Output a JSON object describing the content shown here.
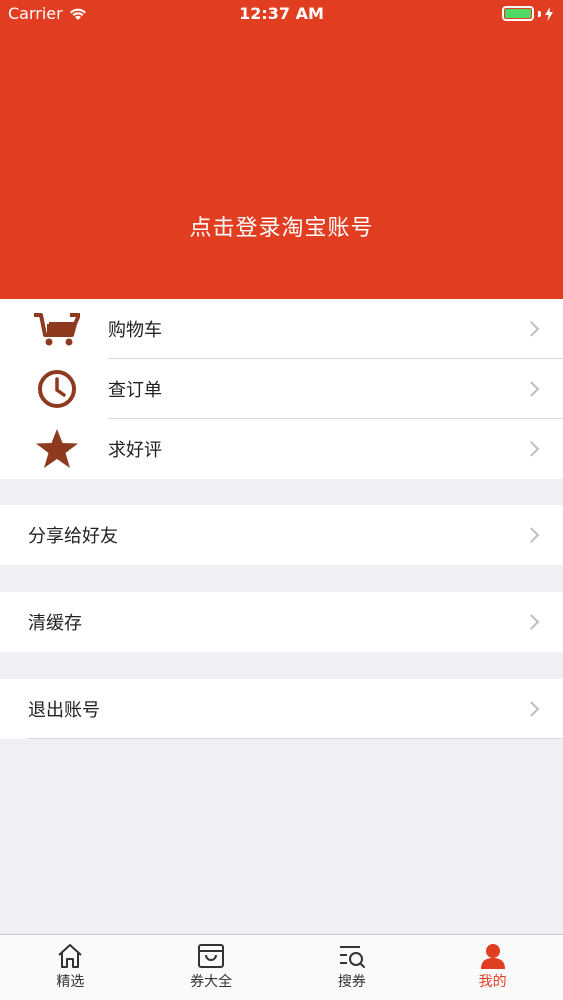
{
  "status_bar": {
    "carrier": "Carrier",
    "time": "12:37 AM"
  },
  "header": {
    "login_text": "点击登录淘宝账号",
    "background": "#e13d21"
  },
  "menu_main": [
    {
      "label": "购物车",
      "icon": "cart-icon"
    },
    {
      "label": "查订单",
      "icon": "clock-icon"
    },
    {
      "label": "求好评",
      "icon": "star-icon"
    }
  ],
  "menu_share": {
    "label": "分享给好友"
  },
  "menu_cache": {
    "label": "清缓存"
  },
  "menu_logout": {
    "label": "退出账号"
  },
  "tabs": [
    {
      "label": "精选",
      "icon": "home-icon",
      "active": false
    },
    {
      "label": "券大全",
      "icon": "coupon-box-icon",
      "active": false
    },
    {
      "label": "搜券",
      "icon": "search-list-icon",
      "active": false
    },
    {
      "label": "我的",
      "icon": "user-icon",
      "active": true
    }
  ],
  "colors": {
    "accent": "#e13d21",
    "icon_brown": "#8e3a1e",
    "battery": "#4cd964"
  }
}
